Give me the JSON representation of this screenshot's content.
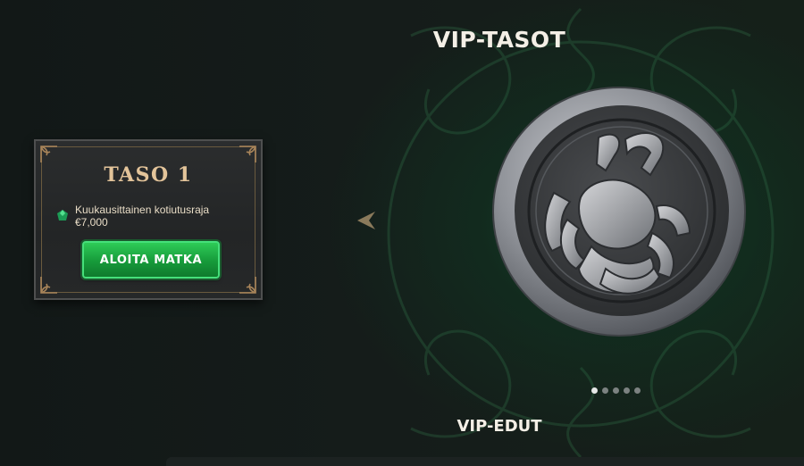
{
  "header": {
    "title": "VIP-TASOT"
  },
  "level_card": {
    "title": "TASO 1",
    "benefit_icon": "emerald-gem-icon",
    "benefit_label": "Kuukausittainen kotiutusraja",
    "benefit_value": "€7,000",
    "cta_label": "ALOITA MATKA"
  },
  "carousel": {
    "prev_icon": "chevron-left-icon",
    "image": "scorpion-medallion",
    "active_index": 0,
    "dot_count": 5
  },
  "footer": {
    "section_title": "VIP-EDUT"
  },
  "colors": {
    "accent_green": "#1fa84a",
    "card_title_gold": "#e3c49a",
    "background": "#141a19"
  }
}
